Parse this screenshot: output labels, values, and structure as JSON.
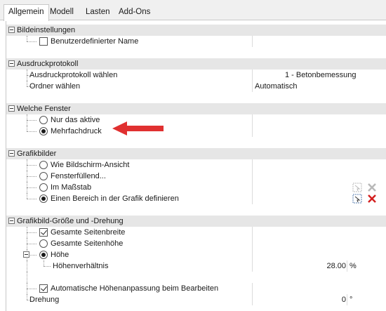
{
  "tabs": [
    "Allgemein",
    "Modell",
    "Lasten",
    "Add-Ons"
  ],
  "sections": {
    "bild": {
      "title": "Bildeinstellungen",
      "custom_name": "Benutzerdefinierter Name"
    },
    "druck": {
      "title": "Ausdruckprotokoll",
      "protocol_label": "Ausdruckprotokoll wählen",
      "protocol_value": "1 - Betonbemessung",
      "folder_label": "Ordner wählen",
      "folder_value": "Automatisch"
    },
    "fenster": {
      "title": "Welche Fenster",
      "opt1": "Nur das aktive",
      "opt2": "Mehrfachdruck",
      "annotation_color": "#e03030"
    },
    "grafik": {
      "title": "Grafikbilder",
      "opt1": "Wie Bildschirm-Ansicht",
      "opt2": "Fensterfüllend...",
      "opt3": "Im Maßstab",
      "opt4": "Einen Bereich in der Grafik definieren"
    },
    "groesse": {
      "title": "Grafikbild-Größe und -Drehung",
      "opt1": "Gesamte Seitenbreite",
      "opt2": "Gesamte Seitenhöhe",
      "opt3": "Höhe",
      "ratio_label": "Höhenverhältnis",
      "ratio_value": "28.00",
      "ratio_unit": "%",
      "auto_label": "Automatische Höhenanpassung beim Bearbeiten",
      "rot_label": "Drehung",
      "rot_value": "0",
      "rot_unit": "°"
    }
  }
}
